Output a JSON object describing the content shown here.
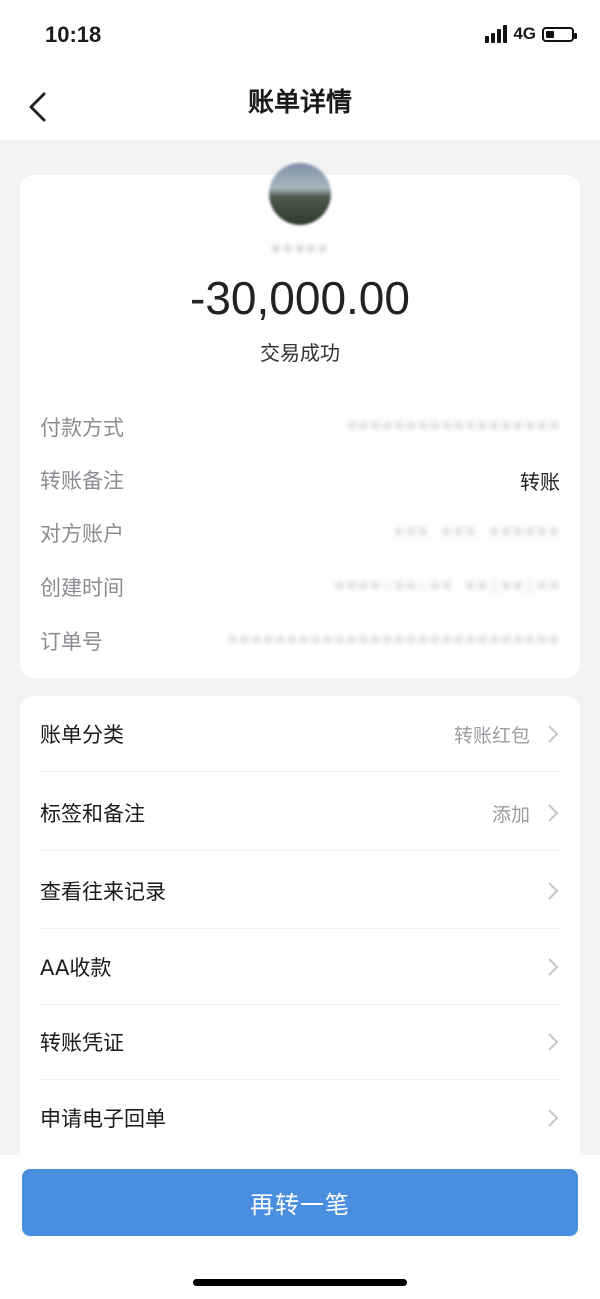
{
  "status_bar": {
    "time": "10:18",
    "network": "4G",
    "battery_level": 0.35
  },
  "nav": {
    "title": "账单详情",
    "back_icon": "chevron-left-icon"
  },
  "summary": {
    "payee_name": "•••••",
    "amount": "-30,000.00",
    "status": "交易成功"
  },
  "details": [
    {
      "label": "付款方式",
      "value": "••••••••••••••••••",
      "blurred": true
    },
    {
      "label": "转账备注",
      "value": "转账",
      "blurred": false
    },
    {
      "label": "对方账户",
      "value": "••• ••• ••••••",
      "blurred": true
    },
    {
      "label": "创建时间",
      "value": "••••-••-•• ••:••:••",
      "blurred": true
    },
    {
      "label": "订单号",
      "value": "••••••••••••••••••••••••••••",
      "blurred": true
    }
  ],
  "menu": [
    {
      "label": "账单分类",
      "value": "转账红包"
    },
    {
      "label": "标签和备注",
      "value": "添加"
    },
    {
      "label": "查看往来记录",
      "value": ""
    },
    {
      "label": "AA收款",
      "value": ""
    },
    {
      "label": "转账凭证",
      "value": ""
    },
    {
      "label": "申请电子回单",
      "value": ""
    }
  ],
  "cta": {
    "label": "再转一笔"
  },
  "colors": {
    "accent": "#4a8ee0",
    "background": "#f2f3f5",
    "muted": "#8a8d91"
  }
}
